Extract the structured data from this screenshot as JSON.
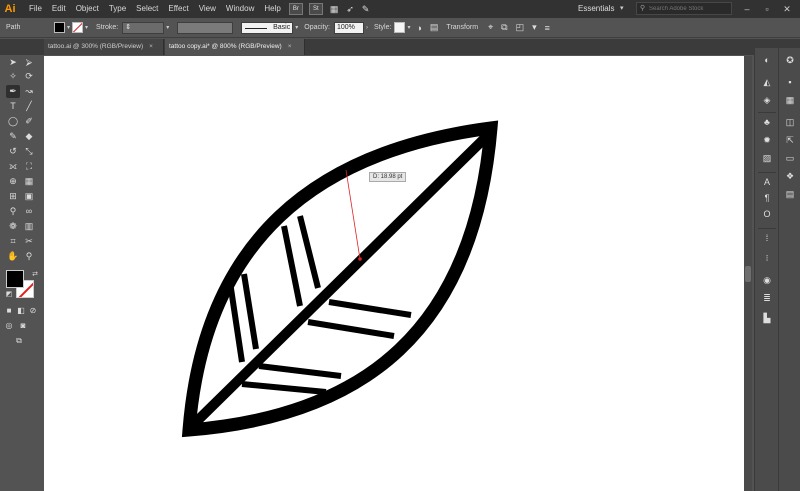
{
  "app": {
    "logo": "Ai"
  },
  "menu": [
    "File",
    "Edit",
    "Object",
    "Type",
    "Select",
    "Effect",
    "View",
    "Window",
    "Help"
  ],
  "menu_icons": [
    "Br",
    "St"
  ],
  "workspace": {
    "label": "Essentials",
    "search_placeholder": "Search Adobe Stock"
  },
  "control": {
    "selection": "Path",
    "stroke_label": "Stroke:",
    "brush_label": "Basic",
    "opacity_label": "Opacity:",
    "opacity_value": "100%",
    "style_label": "Style:",
    "transform_label": "Transform"
  },
  "tabs": [
    {
      "label": "tattoo.ai @ 300% (RGB/Preview)",
      "close": "×",
      "active": false
    },
    {
      "label": "tattoo copy.ai* @ 800% (RGB/Preview)",
      "close": "×",
      "active": true
    }
  ],
  "canvas": {
    "measure_tooltip": "D: 18.98 pt"
  },
  "colors": {
    "fill": "#000000",
    "stroke": "#ffffff",
    "accent": "#ff9a00",
    "guide": "#e02020"
  }
}
